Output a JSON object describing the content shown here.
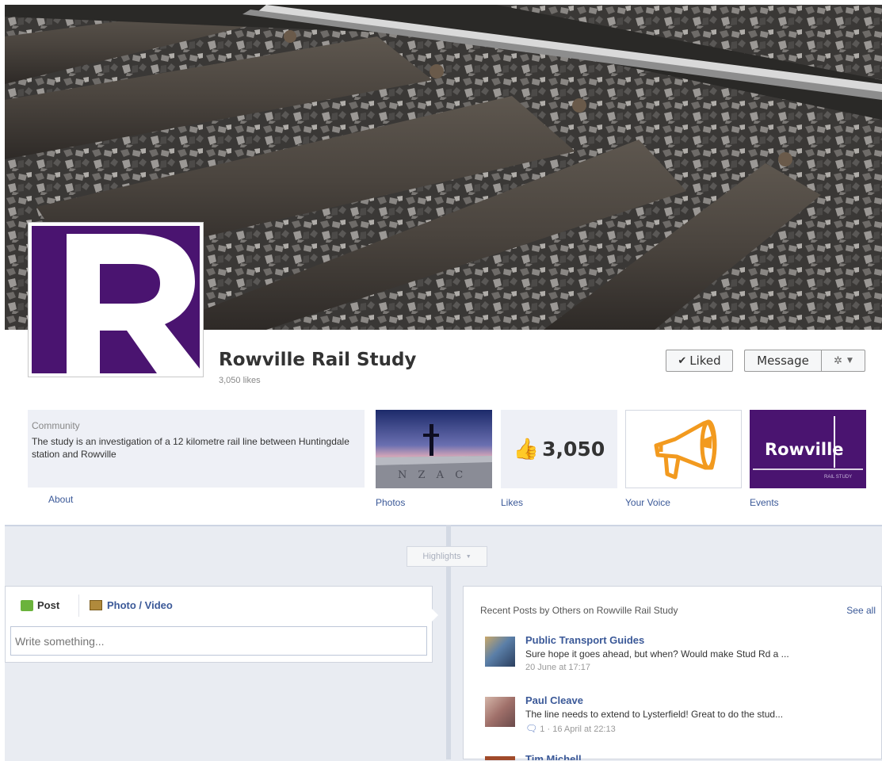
{
  "page": {
    "name": "Rowville Rail Study",
    "likes_text": "3,050 likes"
  },
  "profile_logo": {
    "letter": "R",
    "color": "#4a1470"
  },
  "actions": {
    "liked_label": "Liked",
    "message_label": "Message"
  },
  "about": {
    "category": "Community",
    "description": "The study is an investigation of a 12 kilometre rail line between Huntingdale station and Rowville",
    "link_label": "About"
  },
  "tabs": [
    {
      "label": "Photos",
      "thumb_text": "N Z A C"
    },
    {
      "label": "Likes",
      "count": "3,050"
    },
    {
      "label": "Your Voice"
    },
    {
      "label": "Events",
      "logo_text": "Rowville",
      "logo_subtext": "RAIL STUDY"
    }
  ],
  "timeline": {
    "highlights_label": "Highlights"
  },
  "composer": {
    "post_tab": "Post",
    "photo_tab": "Photo / Video",
    "placeholder": "Write something..."
  },
  "recent_posts": {
    "title": "Recent Posts by Others on Rowville Rail Study",
    "see_all": "See all",
    "items": [
      {
        "author": "Public Transport Guides",
        "text": "Sure hope it goes ahead, but when? Would make Stud Rd a ...",
        "time": "20 June at 17:17",
        "comments": ""
      },
      {
        "author": "Paul Cleave",
        "text": "The line needs to extend to Lysterfield! Great to do the stud...",
        "time": "16 April at 22:13",
        "comments": "1"
      },
      {
        "author": "Tim Michell",
        "text": "",
        "time": "",
        "comments": ""
      }
    ]
  },
  "colors": {
    "brand_purple": "#4a1470",
    "link_blue": "#3b5998",
    "voice_orange": "#f29a1f"
  }
}
